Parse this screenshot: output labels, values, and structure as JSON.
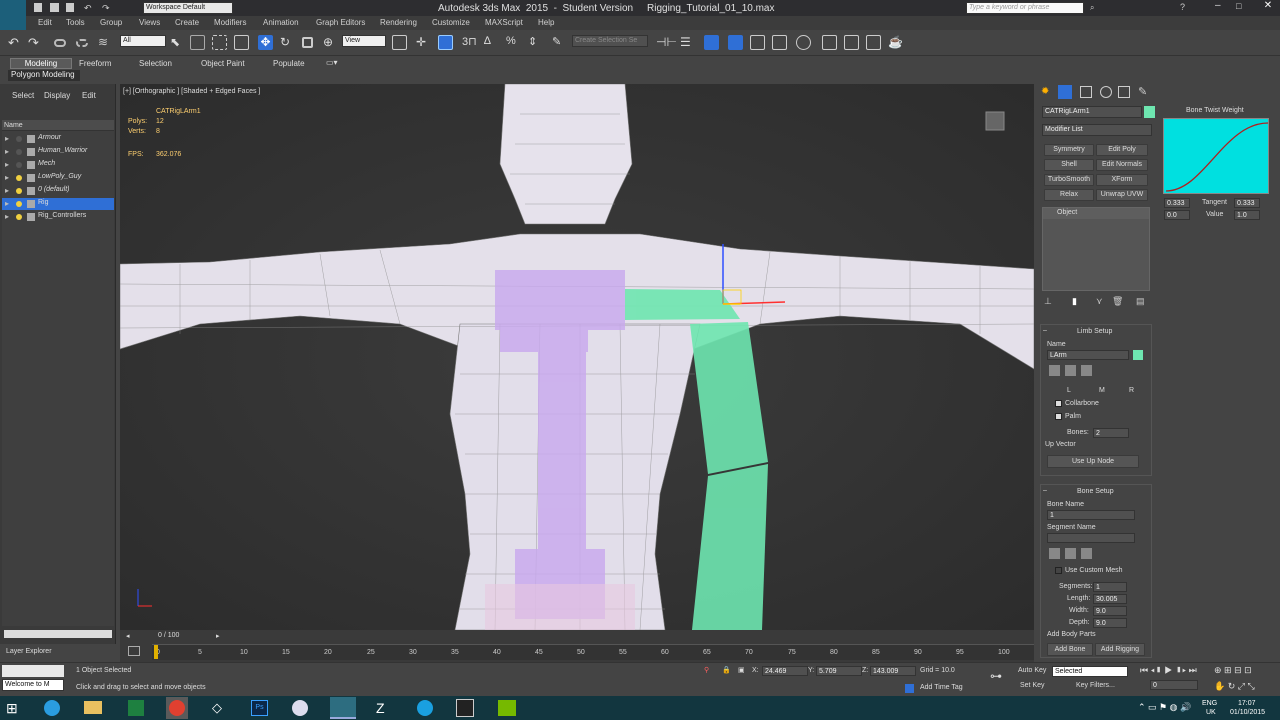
{
  "window": {
    "title": "Autodesk 3ds Max  2015  -  Student Version     Rigging_Tutorial_01_10.max",
    "workspace": "Workspace Default",
    "search_placeholder": "Type a keyword or phrase"
  },
  "menu": [
    "Edit",
    "Tools",
    "Group",
    "Views",
    "Create",
    "Modifiers",
    "Animation",
    "Graph Editors",
    "Rendering",
    "Customize",
    "MAXScript",
    "Help"
  ],
  "toolbar": {
    "selection_filter": "All",
    "ref_coord": "View",
    "named_selection_placeholder": "Create Selection Se"
  },
  "ribbon": {
    "tabs": [
      "Modeling",
      "Freeform",
      "Selection",
      "Object Paint",
      "Populate"
    ],
    "sub_label": "Polygon Modeling"
  },
  "scene_explorer": {
    "tabs": [
      "Select",
      "Display",
      "Edit"
    ],
    "column": "Name",
    "layers": [
      "Armour",
      "Human_Warrior",
      "Mech",
      "LowPoly_Guy",
      "0 (default)",
      "Rig",
      "Rig_Controllers"
    ],
    "selected_index": 5,
    "footer": "Layer Explorer"
  },
  "viewport": {
    "label": "[+] [Orthographic ] [Shaded + Edged Faces ]",
    "object_name": "CATRigLArm1",
    "polys_label": "Polys:",
    "polys_value": "12",
    "verts_label": "Verts:",
    "verts_value": "8",
    "fps_label": "FPS:",
    "fps_value": "362.076"
  },
  "command_panel": {
    "object_name": "CATRigLArm1",
    "object_color": "#6ee6b0",
    "modifier_list": "Modifier List",
    "modifier_buttons": [
      "Symmetry",
      "Edit Poly",
      "Shell",
      "Edit Normals",
      "TurboSmooth",
      "XForm",
      "Relax",
      "Unwrap UVW"
    ],
    "stack_item": "Object",
    "limb_setup": {
      "title": "Limb Setup",
      "name_label": "Name",
      "name_value": "LArm",
      "lmr": [
        "L",
        "M",
        "R"
      ],
      "collarbone": "Collarbone",
      "palm": "Palm",
      "bones_label": "Bones:",
      "bones_value": "2",
      "up_vector": "Up Vector",
      "use_up_node": "Use Up Node"
    },
    "bone_setup": {
      "title": "Bone Setup",
      "bone_name_label": "Bone Name",
      "bone_name_value": "1",
      "segment_name_label": "Segment Name",
      "use_custom_mesh": "Use Custom Mesh",
      "segments_label": "Segments:",
      "segments_value": "1",
      "length_label": "Length:",
      "length_value": "30.005",
      "width_label": "Width:",
      "width_value": "9.0",
      "depth_label": "Depth:",
      "depth_value": "9.0",
      "add_body_parts": "Add Body Parts",
      "add_bone": "Add Bone",
      "add_rigging": "Add Rigging"
    }
  },
  "bone_twist": {
    "title": "Bone Twist Weight",
    "v1": "0.333",
    "tangent_label": "Tangent",
    "tangent_value": "0.333",
    "v2": "0.0",
    "value_label": "Value",
    "value_value": "1.0"
  },
  "timeline": {
    "frame": "0 / 100",
    "ticks": [
      "0",
      "5",
      "10",
      "15",
      "20",
      "25",
      "30",
      "35",
      "40",
      "45",
      "50",
      "55",
      "60",
      "65",
      "70",
      "75",
      "80",
      "85",
      "90",
      "95",
      "100"
    ]
  },
  "status": {
    "maxscript": "Welcome to M",
    "selected": "1 Object Selected",
    "prompt": "Click and drag to select and move objects",
    "x_label": "X:",
    "x_value": "24.469",
    "y_label": "Y:",
    "y_value": "5.709",
    "z_label": "Z:",
    "z_value": "143.009",
    "grid": "Grid = 10.0",
    "add_time_tag": "Add Time Tag",
    "auto_key": "Auto Key",
    "set_key": "Set Key",
    "key_mode": "Selected",
    "key_filters": "Key Filters...",
    "frame_field": "0"
  },
  "taskbar": {
    "lang": "ENG",
    "region": "UK",
    "time": "17:07",
    "date": "01/10/2015"
  },
  "colors": {
    "accent": "#2f6fd6",
    "bone_green": "#6ee6b0",
    "spine_purple": "#c8a8ee",
    "curve_bg": "#00e0e0"
  }
}
